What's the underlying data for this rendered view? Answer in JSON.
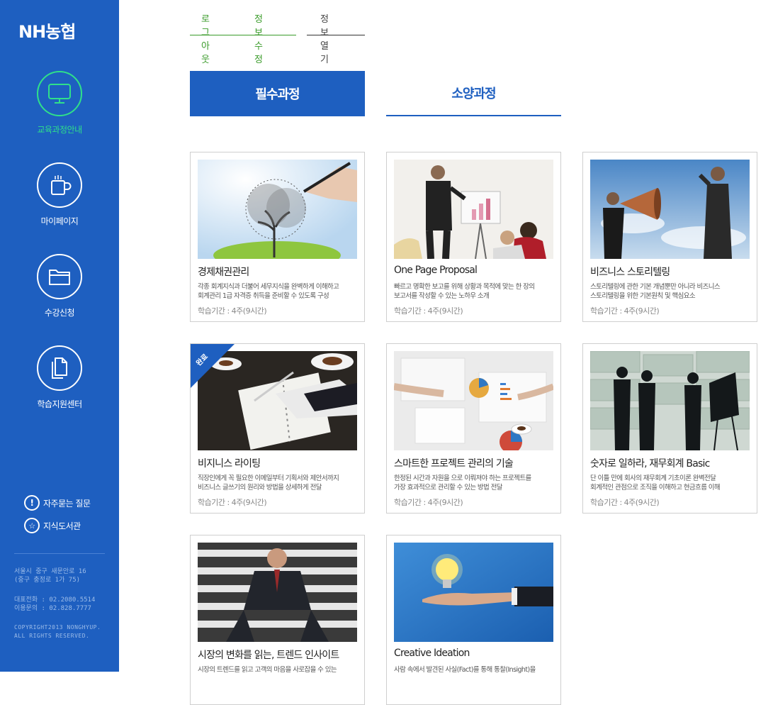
{
  "brand": {
    "logo": "NH농협"
  },
  "sidebar": {
    "items": [
      {
        "label": "교육과정안내",
        "icon": "monitor-icon",
        "active": true
      },
      {
        "label": "마이페이지",
        "icon": "cup-icon",
        "active": false
      },
      {
        "label": "수강신청",
        "icon": "folder-icon",
        "active": false
      },
      {
        "label": "학습지원센터",
        "icon": "document-icon",
        "active": false
      }
    ],
    "help": [
      {
        "label": "자주묻는 질문",
        "icon": "exclamation-icon",
        "symbol": "!"
      },
      {
        "label": "지식도서관",
        "icon": "star-icon",
        "symbol": "☆"
      }
    ],
    "address": [
      "서울시 중구 새문안로 16",
      "(중구 충정로 1가 75)"
    ],
    "contact": [
      "대표전화 : 02.2080.5514",
      "이용문의 : 02.828.7777"
    ],
    "copyright": [
      "COPYRIGHT2013 NONGHYUP.",
      "ALL RIGHTS RESERVED."
    ]
  },
  "topnav": {
    "logout": "로그아웃",
    "edit": "정보수정",
    "view": "정보열기"
  },
  "tabs": {
    "required": "필수과정",
    "elective": "소양과정"
  },
  "courses": [
    {
      "title": "경제채권관리",
      "desc": [
        "각종 회계지식과 더불어 세무지식을 완벽하게 이해하고",
        "회계관리 1급 자격증 취득을 준비할 수 있도록 구성"
      ],
      "period": "학습기간 : 4주(9시간)"
    },
    {
      "title": "One Page Proposal",
      "desc": [
        "빠르고 명확한 보고를 위해 상황과 목적에 맞는 한 장의",
        "보고서를 작성할 수 있는 노하우 소개"
      ],
      "period": "학습기간 : 4주(9시간)"
    },
    {
      "title": "비즈니스 스토리텔링",
      "desc": [
        "스토리텔링에 관한 기본 개념뿐만 아니라 비즈니스",
        "스토리텔링을 위한 기본원칙 및 핵심요소"
      ],
      "period": "학습기간 : 4주(9시간)"
    },
    {
      "title": "비지니스 라이팅",
      "badge": "완료",
      "desc": [
        "직장인에게 꼭 필요한 이메일부터 기획서와 제안서까지",
        "비즈니스 글쓰기의 원리와 방법을 상세하게 전달"
      ],
      "period": "학습기간 : 4주(9시간)"
    },
    {
      "title": "스마트한 프로젝트 관리의 기술",
      "desc": [
        "한정된 시간과 자원을 으로 이뤄져야 하는 프로젝트를",
        "가장 효과적으로 관리할 수 있는 방법 전달"
      ],
      "period": "학습기간 : 4주(9시간)"
    },
    {
      "title": "숫자로 일하라, 재무회계 Basic",
      "desc": [
        "단 이틀 만에 회사의 재무회계 기초이론 완벽전달",
        "회계적인 관점으로 조직을 이해하고 현금흐름 이해"
      ],
      "period": "학습기간 : 4주(9시간)"
    },
    {
      "title": "시장의 변화를 읽는, 트렌드 인사이트",
      "desc": [
        "시장의 트렌드를 읽고 고객의 마음을 사로잡을 수 있는",
        ""
      ],
      "period": ""
    },
    {
      "title": "Creative Ideation",
      "desc": [
        "사람 속에서 발견된 사실(Fact)를 통해 통찰(Insight)을",
        ""
      ],
      "period": ""
    }
  ],
  "colors": {
    "sidebar": "#1e5fc0",
    "active": "#2fe08a",
    "accent": "#1e5fc0",
    "green_nav": "#3a9b2a"
  }
}
